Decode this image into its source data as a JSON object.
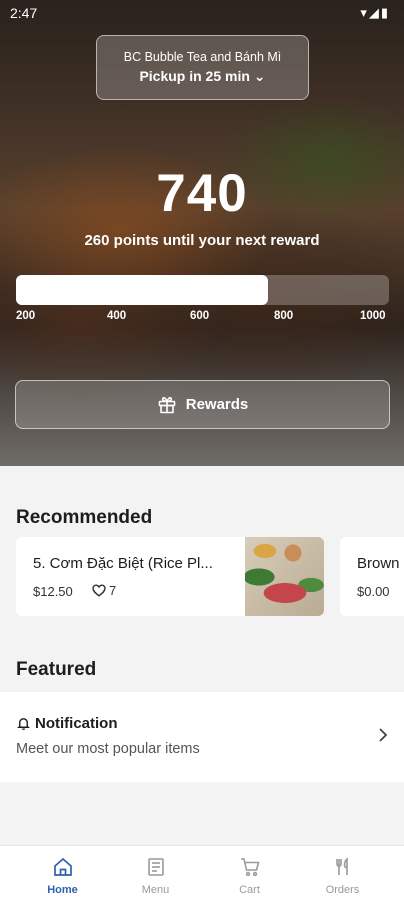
{
  "status_bar": {
    "time": "2:47",
    "icons": "▾◢▮"
  },
  "store": {
    "name": "BC Bubble Tea and Bánh Mì",
    "pickup": "Pickup in 25 min ⌄"
  },
  "points": {
    "value": "740",
    "subtitle": "260 points until your next reward",
    "progress_value": 740,
    "progress_min": 200,
    "progress_max": 1000
  },
  "progress_labels": [
    "200",
    "400",
    "600",
    "800",
    "1000"
  ],
  "rewards_button": {
    "label": "Rewards",
    "icon": "gift-icon"
  },
  "recommended": {
    "title": "Recommended",
    "items": [
      {
        "title": "5. Cơm Đặc Biệt (Rice Pl...",
        "price": "$12.50",
        "likes": "7"
      },
      {
        "title": "Brown",
        "price": "$0.00"
      }
    ]
  },
  "featured": {
    "title": "Featured",
    "card": {
      "heading": "Notification",
      "description": "Meet our most popular items"
    }
  },
  "tabs": [
    {
      "label": "Home",
      "icon": "home-icon",
      "active": true
    },
    {
      "label": "Menu",
      "icon": "menu-icon"
    },
    {
      "label": "Cart",
      "icon": "cart-icon"
    },
    {
      "label": "Orders",
      "icon": "orders-icon"
    }
  ],
  "colors": {
    "accent": "#2f62ad",
    "background": "#f3f3f4"
  }
}
